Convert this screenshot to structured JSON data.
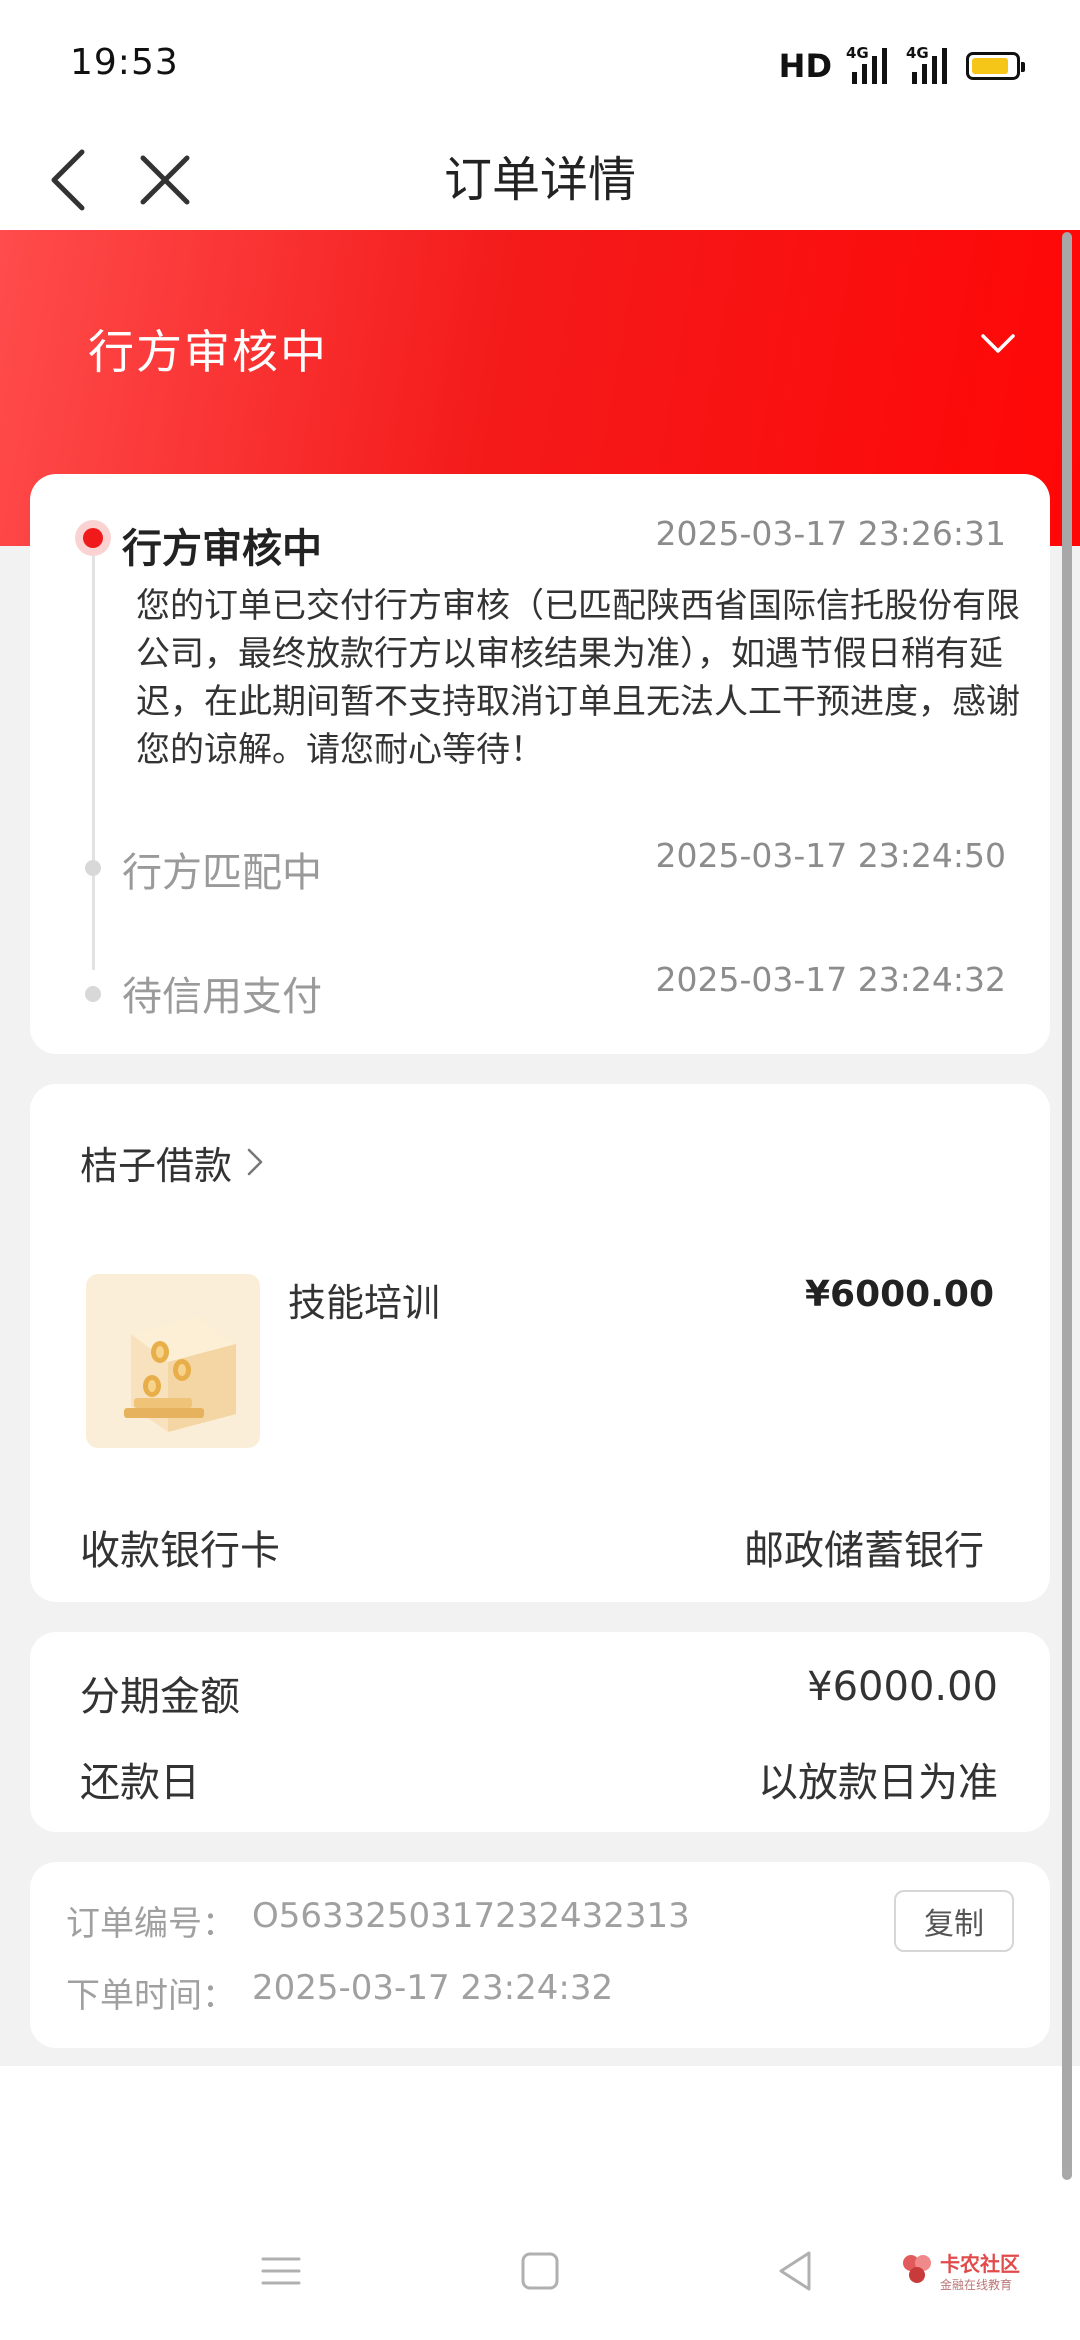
{
  "status_bar": {
    "time": "19:53",
    "hd": "HD",
    "network_1": "4G",
    "network_2": "4G",
    "battery_level": 0.85,
    "battery_color": "#f5c518"
  },
  "nav": {
    "title": "订单详情",
    "back_icon": "chevron-left-icon",
    "close_icon": "close-icon"
  },
  "header": {
    "status": "行方审核中",
    "toggle_icon": "chevron-down-icon",
    "accent_color": "#f41b1b"
  },
  "timeline": [
    {
      "title": "行方审核中",
      "time": "2025-03-17 23:26:31",
      "active": true,
      "description": "您的订单已交付行方审核（已匹配陕西省国际信托股份有限公司，最终放款行方以审核结果为准），如遇节假日稍有延迟，在此期间暂不支持取消订单且无法人工干预进度，感谢您的谅解。请您耐心等待！"
    },
    {
      "title": "行方匹配中",
      "time": "2025-03-17 23:24:50",
      "active": false
    },
    {
      "title": "待信用支付",
      "time": "2025-03-17 23:24:32",
      "active": false
    }
  ],
  "product": {
    "merchant": "桔子借款",
    "name": "技能培训",
    "price": "¥6000.00",
    "image_icon": "coin-stack-icon",
    "bank_label": "收款银行卡",
    "bank_value": "邮政储蓄银行"
  },
  "installment": {
    "amount_label": "分期金额",
    "amount_value": "¥6000.00",
    "due_label": "还款日",
    "due_value": "以放款日为准"
  },
  "order_info": {
    "number_label": "订单编号：",
    "number_value": "O563325031723243231​3",
    "time_label": "下单时间：",
    "time_value": "2025-03-17 23:24:32",
    "copy_label": "复制"
  },
  "watermark": {
    "title": "卡农社区",
    "subtitle": "金融在线教育"
  }
}
